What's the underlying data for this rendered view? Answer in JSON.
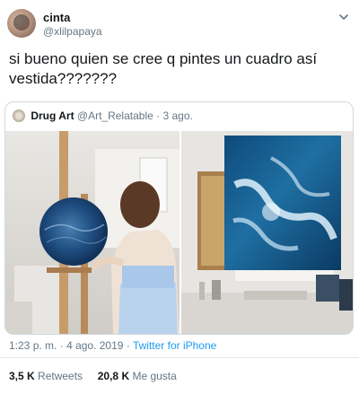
{
  "author": {
    "name": "cinta",
    "handle": "@xlilpapaya",
    "menu_icon": "chevron-down-icon"
  },
  "tweet": {
    "text_line1": "si bueno quien se cree q pintes un cuadro así",
    "text_line2": "vestida???????"
  },
  "quoted": {
    "name": "Drug Art",
    "handle": "@Art_Relatable",
    "separator": "·",
    "date": "3 ago."
  },
  "meta": {
    "time": "1:23 p. m.",
    "separator": "·",
    "date": "4 ago. 2019",
    "source": "Twitter for iPhone"
  },
  "stats": {
    "retweets_count": "3,5 K",
    "retweets_label": "Retweets",
    "likes_count": "20,8 K",
    "likes_label": "Me gusta"
  },
  "colors": {
    "link": "#1d9bf0",
    "muted": "#657786",
    "text": "#14171a",
    "border": "#cfd9de"
  }
}
